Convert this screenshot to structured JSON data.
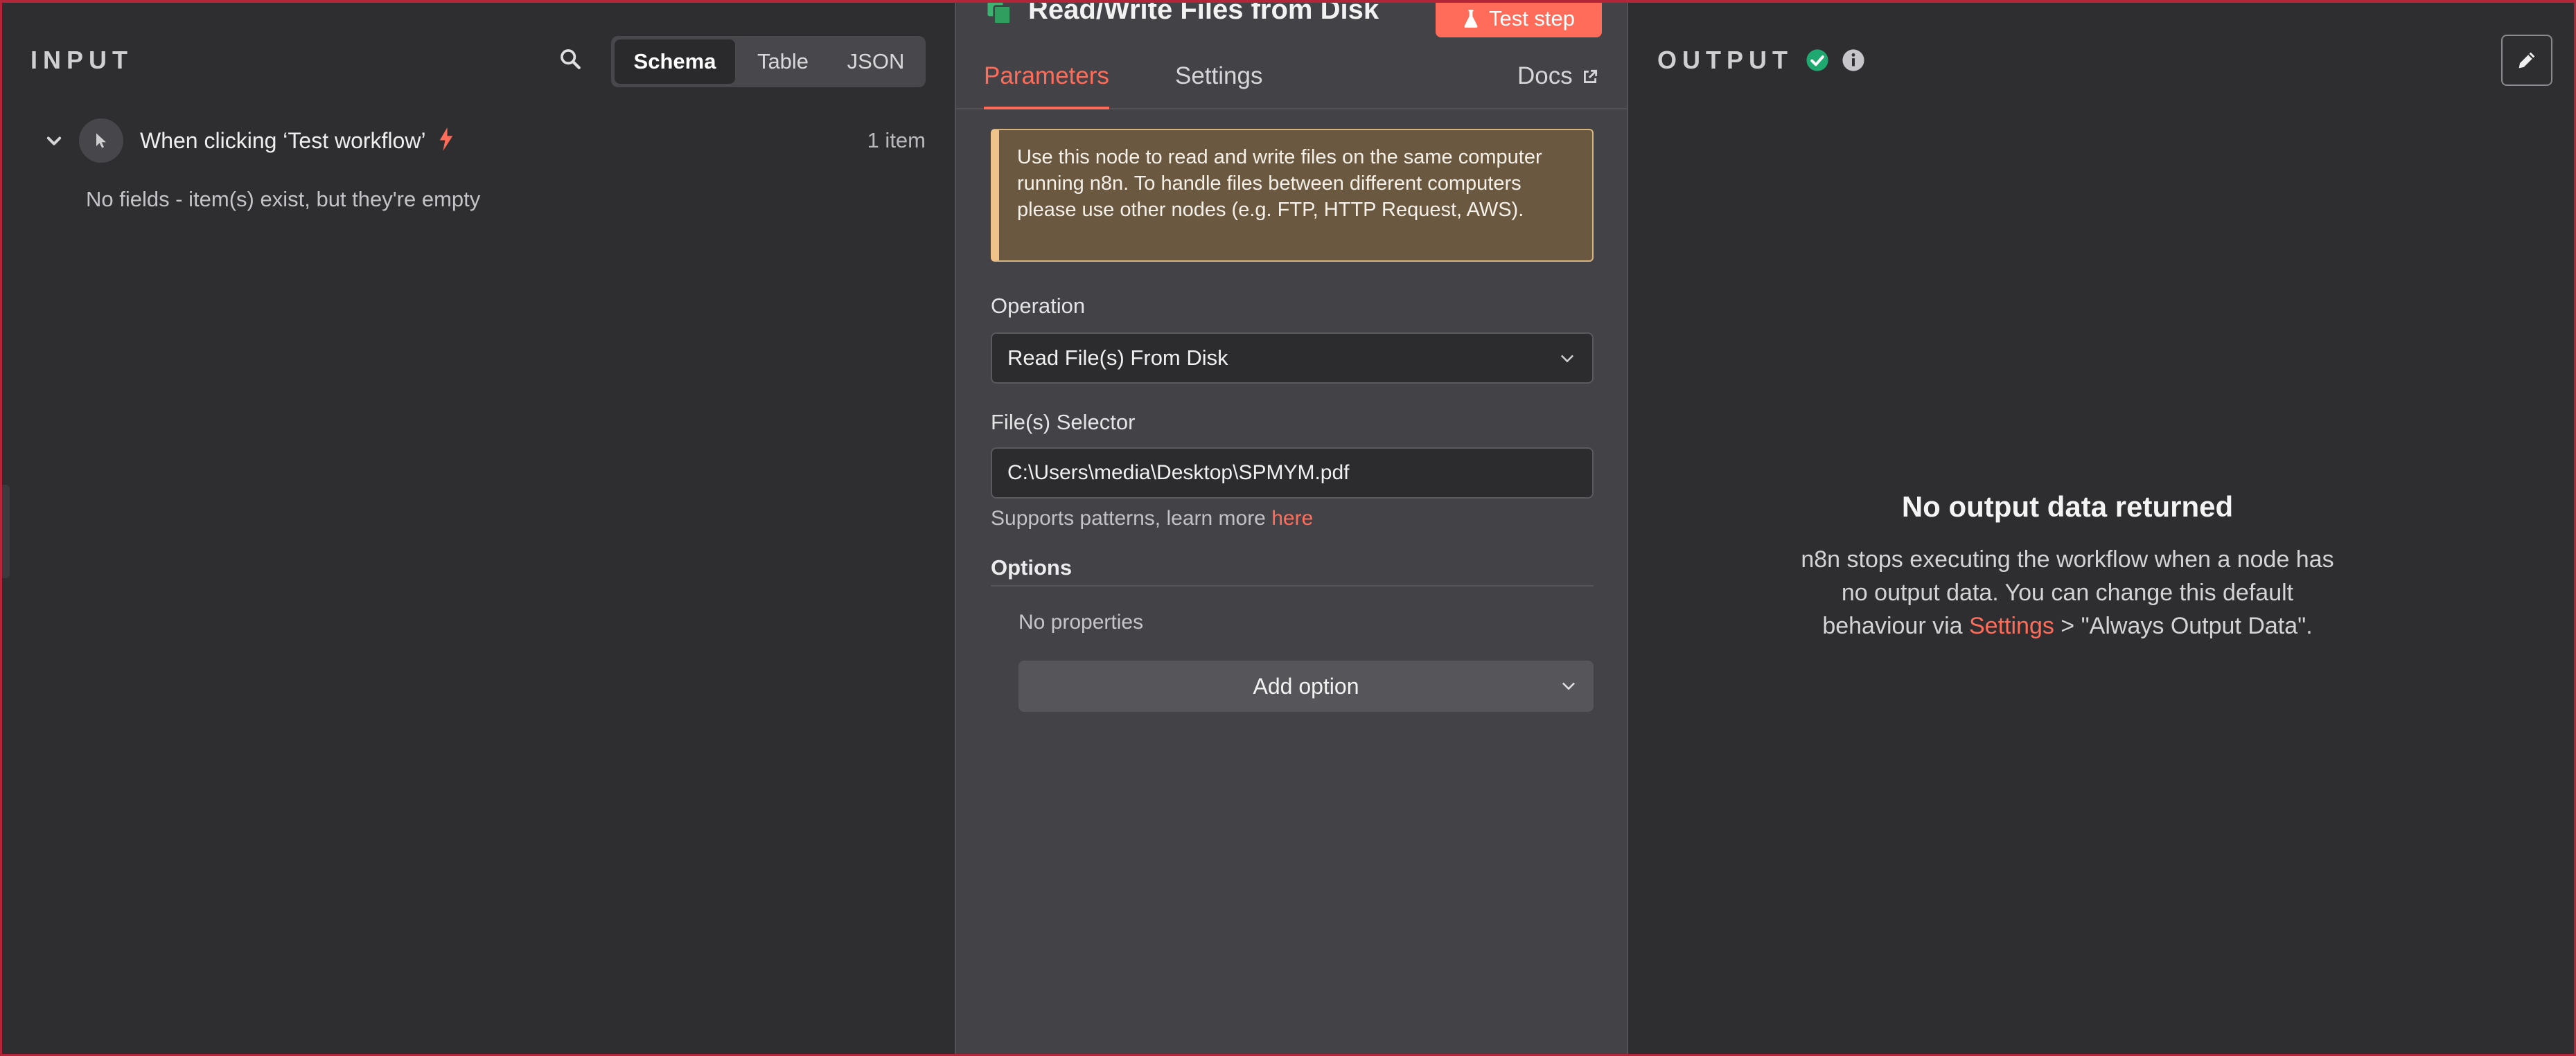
{
  "colors": {
    "accent": "#ff6d5a",
    "success": "#1fa971",
    "notice_bg": "#6a5840",
    "notice_border": "#f0c38a",
    "node_icon": "#3cb371"
  },
  "input": {
    "title": "INPUT",
    "tabs": [
      "Schema",
      "Table",
      "JSON"
    ],
    "active_tab": "Schema",
    "trigger": {
      "label": "When clicking ‘Test workflow’",
      "count": "1 item"
    },
    "empty_note": "No fields - item(s) exist, but they're empty"
  },
  "node": {
    "title": "Read/Write Files from Disk",
    "test_button": "Test step",
    "tabs": {
      "parameters": "Parameters",
      "settings": "Settings",
      "docs": "Docs"
    },
    "notice": "Use this node to read and write files on the same computer running n8n. To handle files between different computers please use other nodes (e.g. FTP, HTTP Request, AWS).",
    "operation": {
      "label": "Operation",
      "value": "Read File(s) From Disk"
    },
    "file_selector": {
      "label": "File(s) Selector",
      "value": "C:\\Users\\media\\Desktop\\SPMYM.pdf"
    },
    "hint_text": "Supports patterns, learn more ",
    "hint_link": "here",
    "options": {
      "title": "Options",
      "empty": "No properties",
      "add_button": "Add option"
    }
  },
  "output": {
    "title": "OUTPUT",
    "heading": "No output data returned",
    "message_pre": "n8n stops executing the workflow when a node has no output data. You can change this default behaviour via ",
    "message_link": "Settings",
    "message_post": " > \"Always Output Data\"."
  },
  "icons": {
    "search": "search-icon",
    "chevron": "chevron-down-icon",
    "cursor": "mouse-pointer-icon",
    "bolt": "lightning-bolt-icon",
    "flask": "flask-icon",
    "external": "external-link-icon",
    "check": "check-circle-icon",
    "info": "info-icon",
    "pencil": "pencil-icon",
    "files": "files-icon"
  }
}
